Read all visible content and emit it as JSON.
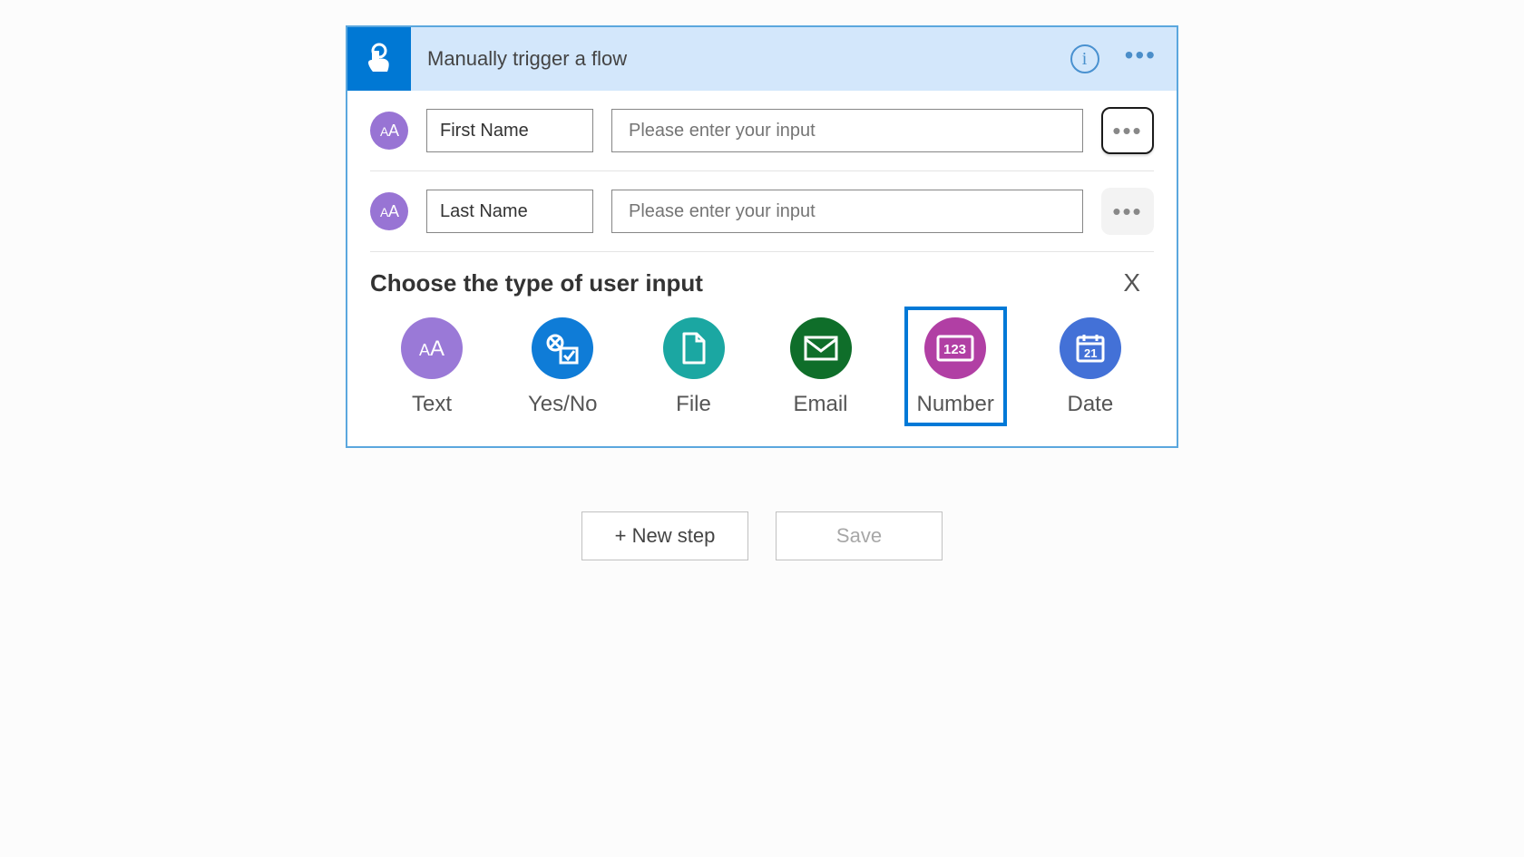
{
  "trigger": {
    "title": "Manually trigger a flow"
  },
  "inputs": [
    {
      "label": "First Name",
      "placeholder": "Please enter your input",
      "more_focused": true
    },
    {
      "label": "Last Name",
      "placeholder": "Please enter your input",
      "more_focused": false
    }
  ],
  "choose": {
    "title": "Choose the type of user input",
    "close": "X",
    "types": [
      {
        "key": "text",
        "label": "Text",
        "selected": false
      },
      {
        "key": "yesno",
        "label": "Yes/No",
        "selected": false
      },
      {
        "key": "file",
        "label": "File",
        "selected": false
      },
      {
        "key": "email",
        "label": "Email",
        "selected": false
      },
      {
        "key": "number",
        "label": "Number",
        "selected": true
      },
      {
        "key": "date",
        "label": "Date",
        "selected": false
      }
    ]
  },
  "footer": {
    "new_step": "+ New step",
    "save": "Save"
  },
  "colors": {
    "accent": "#0078d4",
    "header_bg": "#d3e7fb",
    "card_border": "#5ba7de"
  }
}
